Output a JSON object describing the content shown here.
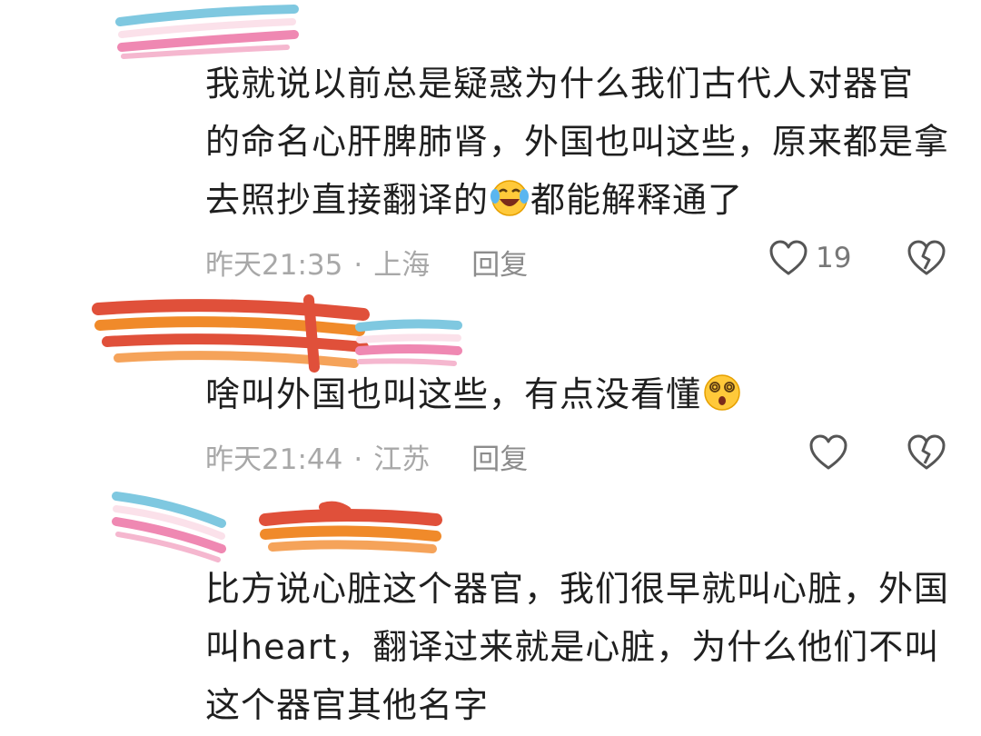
{
  "comments": [
    {
      "lines": [
        "我就说以前总是疑惑为什么我们古代人对器官",
        "的命名心肝脾肺肾，外国也叫这些，原来都是拿",
        "去照抄直接翻译的"
      ],
      "emoji": "laugh-cry-emoji",
      "line3_suffix": "都能解释通了",
      "time": "昨天21:35",
      "location": "上海",
      "reply": "回复",
      "likes": "19"
    },
    {
      "text": "啥叫外国也叫这些，有点没看懂",
      "emoji": "dizzy-face-emoji",
      "time": "昨天21:44",
      "location": "江苏",
      "reply": "回复"
    },
    {
      "lines": [
        "比方说心脏这个器官，我们很早就叫心脏，外国",
        "叫heart，翻译过来就是心脏，为什么他们不叫",
        "这个器官其他名字"
      ]
    }
  ],
  "meta_separator": "·",
  "colors": {
    "scribble_blue": "#7fc8e0",
    "scribble_pink": "#ef88b2",
    "scribble_orange": "#f08a2a",
    "scribble_red": "#e0503a",
    "meta_gray": "#a8a8a8"
  }
}
